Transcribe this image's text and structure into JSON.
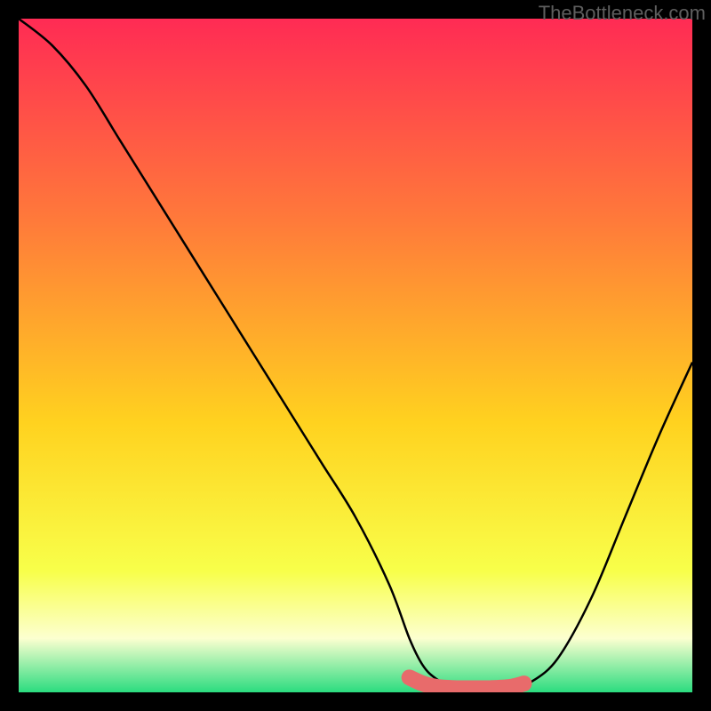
{
  "watermark": "TheBottleneck.com",
  "colors": {
    "gradient_top": "#ff2b54",
    "gradient_upper": "#ff7a3a",
    "gradient_mid": "#ffd21f",
    "gradient_lower": "#f8ff4a",
    "gradient_cream": "#fcffd0",
    "gradient_green": "#2bdc7f",
    "curve": "#000000",
    "marker_fill": "#e86b6b",
    "marker_stroke": "#e86b6b"
  },
  "chart_data": {
    "type": "line",
    "title": "",
    "xlabel": "",
    "ylabel": "",
    "xlim": [
      0,
      100
    ],
    "ylim": [
      0,
      100
    ],
    "series": [
      {
        "name": "bottleneck-curve",
        "x": [
          0,
          5,
          10,
          15,
          20,
          25,
          30,
          35,
          40,
          45,
          50,
          55,
          58,
          60,
          62,
          65,
          68,
          70,
          73,
          76,
          80,
          85,
          90,
          95,
          100
        ],
        "y": [
          100,
          96,
          90,
          82,
          74,
          66,
          58,
          50,
          42,
          34,
          26,
          16,
          8,
          4,
          2,
          0.5,
          0.5,
          0.5,
          0.5,
          1.5,
          5,
          14,
          26,
          38,
          49
        ]
      }
    ],
    "optimal_band": {
      "name": "optimal-region",
      "x": [
        58,
        60,
        62,
        65,
        68,
        70,
        73,
        75
      ],
      "y": [
        2.2,
        1.3,
        0.8,
        0.6,
        0.6,
        0.6,
        0.8,
        1.3
      ]
    },
    "annotations": []
  }
}
